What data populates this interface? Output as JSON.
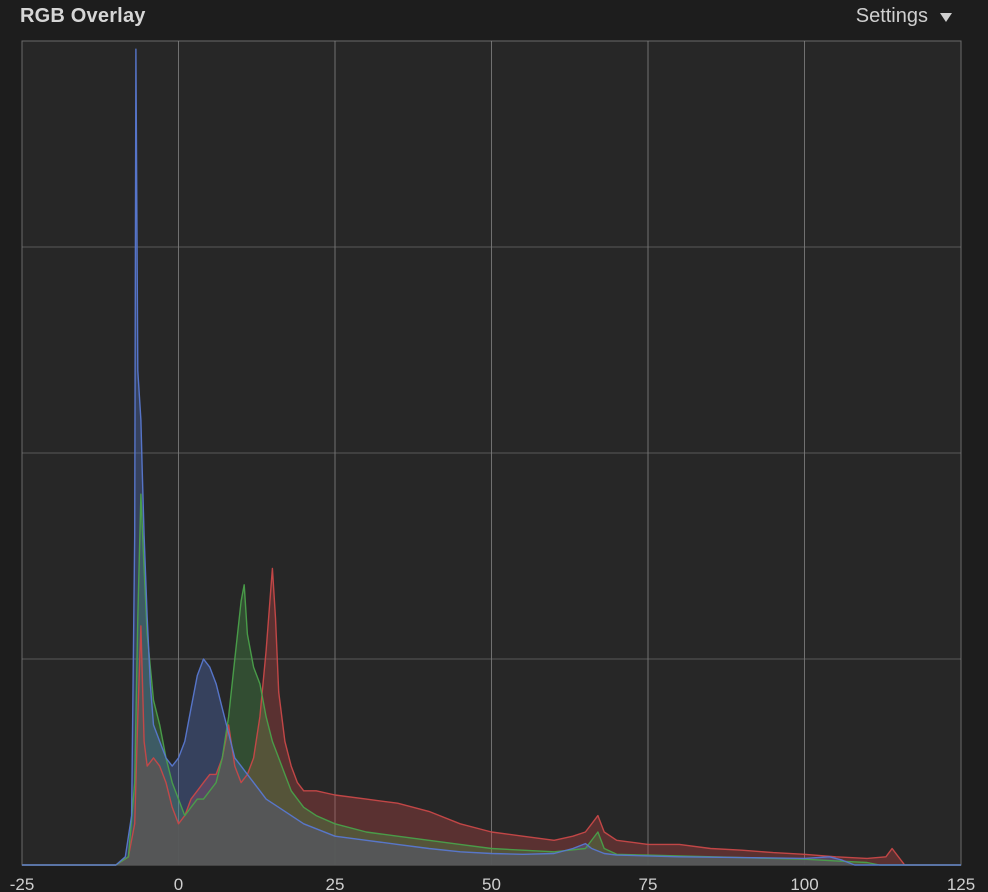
{
  "header": {
    "title": "RGB Overlay",
    "settings_label": "Settings"
  },
  "colors": {
    "background": "#1d1d1d",
    "plot_background": "#272727",
    "grid": "#6a6a6a",
    "red": "#c84848",
    "green": "#4aa04a",
    "blue": "#5878d0",
    "overlap_fill": "#555555"
  },
  "chart_data": {
    "type": "area",
    "title": "RGB Overlay",
    "xlabel": "",
    "ylabel": "",
    "xlim": [
      -25,
      125
    ],
    "ylim": [
      0,
      100
    ],
    "x_ticks": [
      -25,
      0,
      25,
      50,
      75,
      100,
      125
    ],
    "grid": true,
    "horizontal_gridlines": 4,
    "series": [
      {
        "name": "",
        "color_key": "red",
        "points": [
          [
            -25,
            0
          ],
          [
            -10,
            0
          ],
          [
            -8,
            1
          ],
          [
            -7,
            5
          ],
          [
            -6.5,
            18
          ],
          [
            -6,
            29
          ],
          [
            -5.5,
            15
          ],
          [
            -5,
            12
          ],
          [
            -4,
            13
          ],
          [
            -3,
            12
          ],
          [
            -2,
            10
          ],
          [
            -1,
            7
          ],
          [
            0,
            5
          ],
          [
            1,
            6
          ],
          [
            2,
            8
          ],
          [
            3,
            9
          ],
          [
            4,
            10
          ],
          [
            5,
            11
          ],
          [
            6,
            11
          ],
          [
            7,
            13
          ],
          [
            8,
            17
          ],
          [
            9,
            12
          ],
          [
            10,
            10
          ],
          [
            11,
            11
          ],
          [
            12,
            13
          ],
          [
            13,
            18
          ],
          [
            14,
            26
          ],
          [
            15,
            36
          ],
          [
            15.5,
            30
          ],
          [
            16,
            21
          ],
          [
            17,
            15
          ],
          [
            18,
            12
          ],
          [
            19,
            10
          ],
          [
            20,
            9
          ],
          [
            22,
            9
          ],
          [
            25,
            8.5
          ],
          [
            30,
            8
          ],
          [
            35,
            7.5
          ],
          [
            40,
            6.5
          ],
          [
            45,
            5
          ],
          [
            50,
            4
          ],
          [
            55,
            3.5
          ],
          [
            60,
            3
          ],
          [
            63,
            3.5
          ],
          [
            65,
            4
          ],
          [
            66,
            5
          ],
          [
            67,
            6
          ],
          [
            68,
            4
          ],
          [
            70,
            3
          ],
          [
            75,
            2.5
          ],
          [
            80,
            2.5
          ],
          [
            85,
            2
          ],
          [
            90,
            1.8
          ],
          [
            95,
            1.5
          ],
          [
            100,
            1.3
          ],
          [
            105,
            1
          ],
          [
            110,
            0.8
          ],
          [
            113,
            1
          ],
          [
            114,
            2
          ],
          [
            115,
            1
          ],
          [
            116,
            0
          ],
          [
            125,
            0
          ]
        ]
      },
      {
        "name": "",
        "color_key": "green",
        "points": [
          [
            -25,
            0
          ],
          [
            -10,
            0
          ],
          [
            -8,
            1
          ],
          [
            -7,
            10
          ],
          [
            -6.5,
            30
          ],
          [
            -6,
            45
          ],
          [
            -5.5,
            36
          ],
          [
            -5,
            28
          ],
          [
            -4,
            20
          ],
          [
            -3,
            17
          ],
          [
            -2,
            13
          ],
          [
            -1,
            10
          ],
          [
            0,
            8
          ],
          [
            1,
            6
          ],
          [
            2,
            7
          ],
          [
            3,
            8
          ],
          [
            4,
            8
          ],
          [
            5,
            9
          ],
          [
            6,
            10
          ],
          [
            7,
            13
          ],
          [
            8,
            18
          ],
          [
            9,
            25
          ],
          [
            10,
            32
          ],
          [
            10.5,
            34
          ],
          [
            11,
            28
          ],
          [
            12,
            24
          ],
          [
            13,
            22
          ],
          [
            14,
            18
          ],
          [
            15,
            15
          ],
          [
            16,
            13
          ],
          [
            17,
            11
          ],
          [
            18,
            9
          ],
          [
            19,
            8
          ],
          [
            20,
            7
          ],
          [
            22,
            6
          ],
          [
            25,
            5
          ],
          [
            30,
            4
          ],
          [
            35,
            3.5
          ],
          [
            40,
            3
          ],
          [
            45,
            2.5
          ],
          [
            50,
            2
          ],
          [
            55,
            1.8
          ],
          [
            60,
            1.6
          ],
          [
            65,
            2
          ],
          [
            67,
            4
          ],
          [
            68,
            2
          ],
          [
            70,
            1.3
          ],
          [
            75,
            1.2
          ],
          [
            80,
            1.1
          ],
          [
            90,
            0.9
          ],
          [
            100,
            0.7
          ],
          [
            105,
            0.5
          ],
          [
            110,
            0.3
          ],
          [
            112,
            0
          ],
          [
            125,
            0
          ]
        ]
      },
      {
        "name": "",
        "color_key": "blue",
        "points": [
          [
            -25,
            0
          ],
          [
            -10,
            0
          ],
          [
            -8.5,
            1
          ],
          [
            -7.5,
            6
          ],
          [
            -7,
            40
          ],
          [
            -6.8,
            99
          ],
          [
            -6.5,
            60
          ],
          [
            -6,
            54
          ],
          [
            -5.8,
            48
          ],
          [
            -5.5,
            40
          ],
          [
            -5,
            30
          ],
          [
            -4.5,
            22
          ],
          [
            -4,
            17
          ],
          [
            -3,
            15
          ],
          [
            -2,
            13
          ],
          [
            -1,
            12
          ],
          [
            0,
            13
          ],
          [
            1,
            15
          ],
          [
            2,
            19
          ],
          [
            3,
            23
          ],
          [
            4,
            25
          ],
          [
            5,
            24
          ],
          [
            6,
            22
          ],
          [
            7,
            19
          ],
          [
            8,
            16
          ],
          [
            9,
            13
          ],
          [
            10,
            12
          ],
          [
            11,
            11
          ],
          [
            12,
            10
          ],
          [
            13,
            9
          ],
          [
            14,
            8
          ],
          [
            15,
            7.5
          ],
          [
            16,
            7
          ],
          [
            18,
            6
          ],
          [
            20,
            5
          ],
          [
            25,
            3.5
          ],
          [
            30,
            3
          ],
          [
            35,
            2.5
          ],
          [
            40,
            2
          ],
          [
            45,
            1.6
          ],
          [
            50,
            1.4
          ],
          [
            55,
            1.3
          ],
          [
            60,
            1.4
          ],
          [
            63,
            2
          ],
          [
            65,
            2.6
          ],
          [
            66,
            2
          ],
          [
            68,
            1.4
          ],
          [
            70,
            1.2
          ],
          [
            75,
            1.1
          ],
          [
            80,
            1
          ],
          [
            90,
            0.9
          ],
          [
            100,
            0.8
          ],
          [
            104,
            1
          ],
          [
            106,
            0.6
          ],
          [
            108,
            0
          ],
          [
            125,
            0
          ]
        ]
      }
    ]
  }
}
